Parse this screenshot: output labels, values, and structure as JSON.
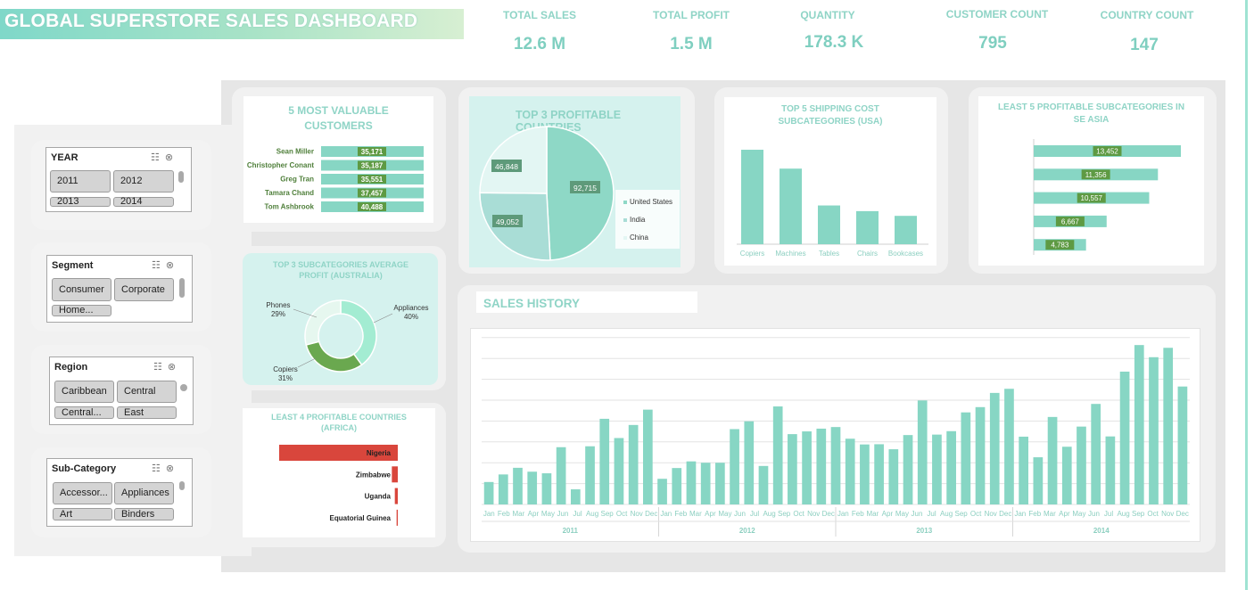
{
  "header": {
    "title": "GLOBAL SUPERSTORE SALES DASHBOARD"
  },
  "kpis": [
    {
      "label": "TOTAL SALES",
      "value": "12.6 M"
    },
    {
      "label": "TOTAL PROFIT",
      "value": "1.5 M"
    },
    {
      "label": "QUANTITY",
      "value": "178.3 K"
    },
    {
      "label": "CUSTOMER COUNT",
      "value": "795"
    },
    {
      "label": "COUNTRY COUNT",
      "value": "147"
    }
  ],
  "slicers": [
    {
      "title": "YEAR",
      "items": [
        "2011",
        "2012",
        "2013",
        "2014"
      ]
    },
    {
      "title": "Segment",
      "items": [
        "Consumer",
        "Corporate",
        "Home..."
      ]
    },
    {
      "title": "Region",
      "items": [
        "Caribbean",
        "Central",
        "Central...",
        "East"
      ]
    },
    {
      "title": "Sub-Category",
      "items": [
        "Accessor...",
        "Appliances",
        "Art",
        "Binders"
      ]
    }
  ],
  "colors": {
    "accent": "#87d6c4",
    "accent_dark": "#6cc4b0",
    "title": "#8fd4c6",
    "red": "#d9463c",
    "green_dark": "#6aa84f",
    "label_green": "#4f7f3a"
  },
  "chart_data": [
    {
      "type": "bar",
      "title": "5 MOST VALUABLE CUSTOMERS",
      "orientation": "horizontal",
      "categories": [
        "Sean Miller",
        "Christopher Conant",
        "Greg Tran",
        "Tamara Chand",
        "Tom Ashbrook"
      ],
      "values": [
        35171,
        35187,
        35551,
        37457,
        40488
      ],
      "value_labels": [
        "35,171",
        "35,187",
        "35,551",
        "37,457",
        "40,488"
      ]
    },
    {
      "type": "pie",
      "title": "TOP  3 PROFITABLE COUNTRIES",
      "categories": [
        "United States",
        "India",
        "China"
      ],
      "values": [
        92715,
        49052,
        46848
      ],
      "value_labels": [
        "92,715",
        "49,052",
        "46,848"
      ],
      "colors": [
        "#8ed8c6",
        "#a9ddd6",
        "#e3f6f3"
      ],
      "legend": "right"
    },
    {
      "type": "bar",
      "title": "TOP 5 SHIPPING COST SUBCATEGORIES (USA)",
      "categories": [
        "Copiers",
        "Machines",
        "Tables",
        "Chairs",
        "Bookcases"
      ],
      "values": [
        100,
        80,
        41,
        35,
        30
      ]
    },
    {
      "type": "bar",
      "title": "LEAST 5 PROFITABLE SUBCATEGORIES IN SE ASIA",
      "orientation": "horizontal",
      "values": [
        13452,
        11356,
        10557,
        6667,
        4783
      ],
      "value_labels": [
        "13,452",
        "11,356",
        "10,557",
        "6,667",
        "4,783"
      ]
    },
    {
      "type": "pie",
      "title": "TOP 3 SUBCATEGORIES AVERAGE PROFIT (AUSTRALIA)",
      "categories": [
        "Appliances",
        "Copiers",
        "Phones"
      ],
      "values": [
        40,
        31,
        29
      ],
      "value_labels": [
        "40%",
        "31%",
        "29%"
      ],
      "colors": [
        "#a3ecd2",
        "#6aa84f",
        "#e6f7ef"
      ]
    },
    {
      "type": "bar",
      "title": "LEAST 4 PROFITABLE COUNTRIES (AFRICA)",
      "orientation": "horizontal",
      "categories": [
        "Nigeria",
        "Zimbabwe",
        "Uganda",
        "Equatorial Guinea"
      ],
      "values": [
        -100,
        -5,
        -2.5,
        -1
      ]
    },
    {
      "type": "bar",
      "title": "SALES HISTORY",
      "months": [
        "Jan",
        "Feb",
        "Mar",
        "Apr",
        "May",
        "Jun",
        "Jul",
        "Aug",
        "Sep",
        "Oct",
        "Nov",
        "Dec"
      ],
      "years": [
        "2011",
        "2012",
        "2013",
        "2014"
      ],
      "values": [
        98,
        131,
        160,
        143,
        136,
        250,
        66,
        254,
        374,
        290,
        347,
        414,
        112,
        159,
        188,
        182,
        182,
        329,
        363,
        168,
        428,
        307,
        319,
        331,
        338,
        287,
        262,
        263,
        241,
        303,
        454,
        305,
        320,
        402,
        425,
        487,
        505,
        296,
        206,
        382,
        252,
        340,
        439,
        297,
        580,
        696,
        643,
        684,
        515
      ],
      "values_note_removed": true
    }
  ]
}
